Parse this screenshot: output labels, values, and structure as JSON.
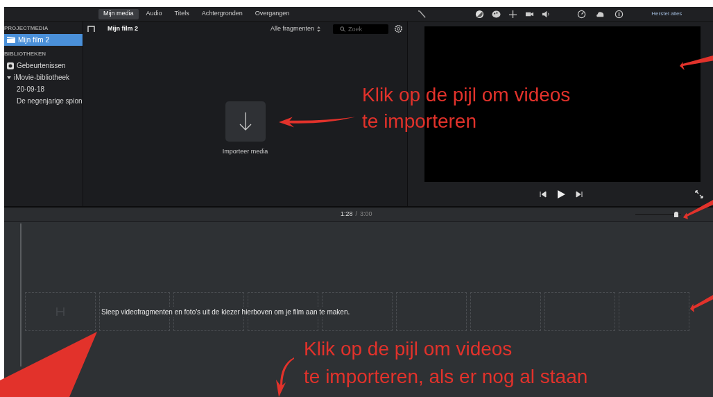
{
  "tabs": [
    {
      "label": "Mijn media",
      "selected": true
    },
    {
      "label": "Audio",
      "selected": false
    },
    {
      "label": "Titels",
      "selected": false
    },
    {
      "label": "Achtergronden",
      "selected": false
    },
    {
      "label": "Overgangen",
      "selected": false
    }
  ],
  "toolbar": {
    "reset_label": "Herstel alles"
  },
  "sidebar": {
    "sections": [
      {
        "heading": "PROJECTMEDIA",
        "items": [
          {
            "label": "Mijn film 2",
            "kind": "project",
            "selected": true
          }
        ]
      },
      {
        "heading": "BIBLIOTHEKEN",
        "items": [
          {
            "label": "Gebeurtenissen",
            "kind": "events",
            "selected": false
          },
          {
            "label": "iMovie-bibliotheek",
            "selected": false,
            "expanded": true,
            "children": [
              {
                "label": "20-09-18",
                "selected": false
              },
              {
                "label": "De negenjarige spion",
                "selected": false
              }
            ]
          }
        ]
      }
    ]
  },
  "browser": {
    "title": "Mijn film 2",
    "filter": "Alle fragmenten",
    "search_placeholder": "Zoek",
    "import_label": "Importeer media"
  },
  "timeline": {
    "time_current": "1:28",
    "time_separator": "/",
    "time_total": "3:00",
    "zoom": {
      "level": 0.9
    },
    "hint": "Sleep videofragmenten en foto's uit de kiezer hierboven om je film aan te maken."
  },
  "annotations": [
    {
      "lines": [
        "Klik op de pijl om videos",
        "te importeren"
      ]
    },
    {
      "lines": [
        "Klik op de pijl om videos",
        "te importeren, als er nog al staan"
      ]
    }
  ]
}
